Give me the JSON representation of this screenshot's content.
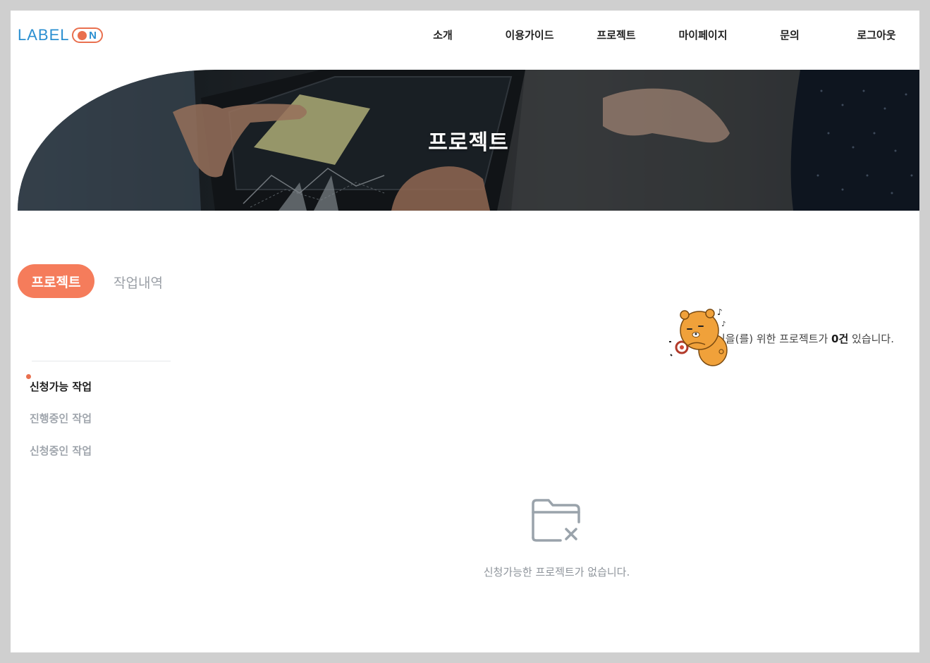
{
  "header": {
    "logo": {
      "label": "LABEL",
      "badge_letter": "N"
    },
    "nav": [
      {
        "id": "about",
        "label": "소개"
      },
      {
        "id": "guide",
        "label": "이용가이드"
      },
      {
        "id": "project",
        "label": "프로젝트"
      },
      {
        "id": "mypage",
        "label": "마이페이지"
      },
      {
        "id": "inquiry",
        "label": "문의"
      },
      {
        "id": "logout",
        "label": "로그아웃"
      }
    ]
  },
  "banner": {
    "title": "프로젝트"
  },
  "tabs": [
    {
      "label": "프로젝트",
      "active": true
    },
    {
      "label": "작업내역",
      "active": false
    }
  ],
  "sidebar": {
    "items": [
      {
        "label": "신청가능 작업",
        "active": true
      },
      {
        "label": "진행중인 작업",
        "active": false
      },
      {
        "label": "신청중인 작업",
        "active": false
      }
    ]
  },
  "main": {
    "welcome_prefix": "님을(를) 위한 프로젝트가 ",
    "welcome_count": "0건",
    "welcome_suffix": " 있습니다.",
    "empty_message": "신청가능한 프로젝트가 없습니다."
  },
  "colors": {
    "accent": "#f57c5b",
    "logo_blue": "#2a8fd1",
    "logo_orange": "#e9704f"
  },
  "icons": {
    "character": "bear-character-icon",
    "empty": "folder-x-icon"
  }
}
